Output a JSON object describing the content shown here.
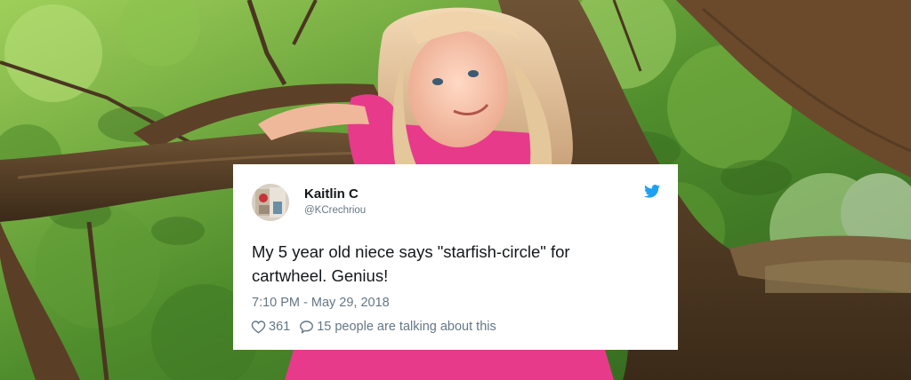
{
  "tweet": {
    "author_name": "Kaitlin C",
    "author_handle": "@KCrechriou",
    "text": "My 5 year old niece says \"starfish-circle\" for cartwheel. Genius!",
    "timestamp": "7:10 PM - May 29, 2018",
    "likes": "361",
    "conversation": "15 people are talking about this"
  },
  "icons": {
    "brand": "twitter-bird-icon",
    "like": "heart-outline-icon",
    "reply": "speech-bubble-icon"
  },
  "colors": {
    "twitter_blue": "#1da1f2",
    "text_primary": "#14171a",
    "text_secondary": "#657786",
    "card_background": "#ffffff",
    "shirt_pink": "#e83a8a"
  }
}
